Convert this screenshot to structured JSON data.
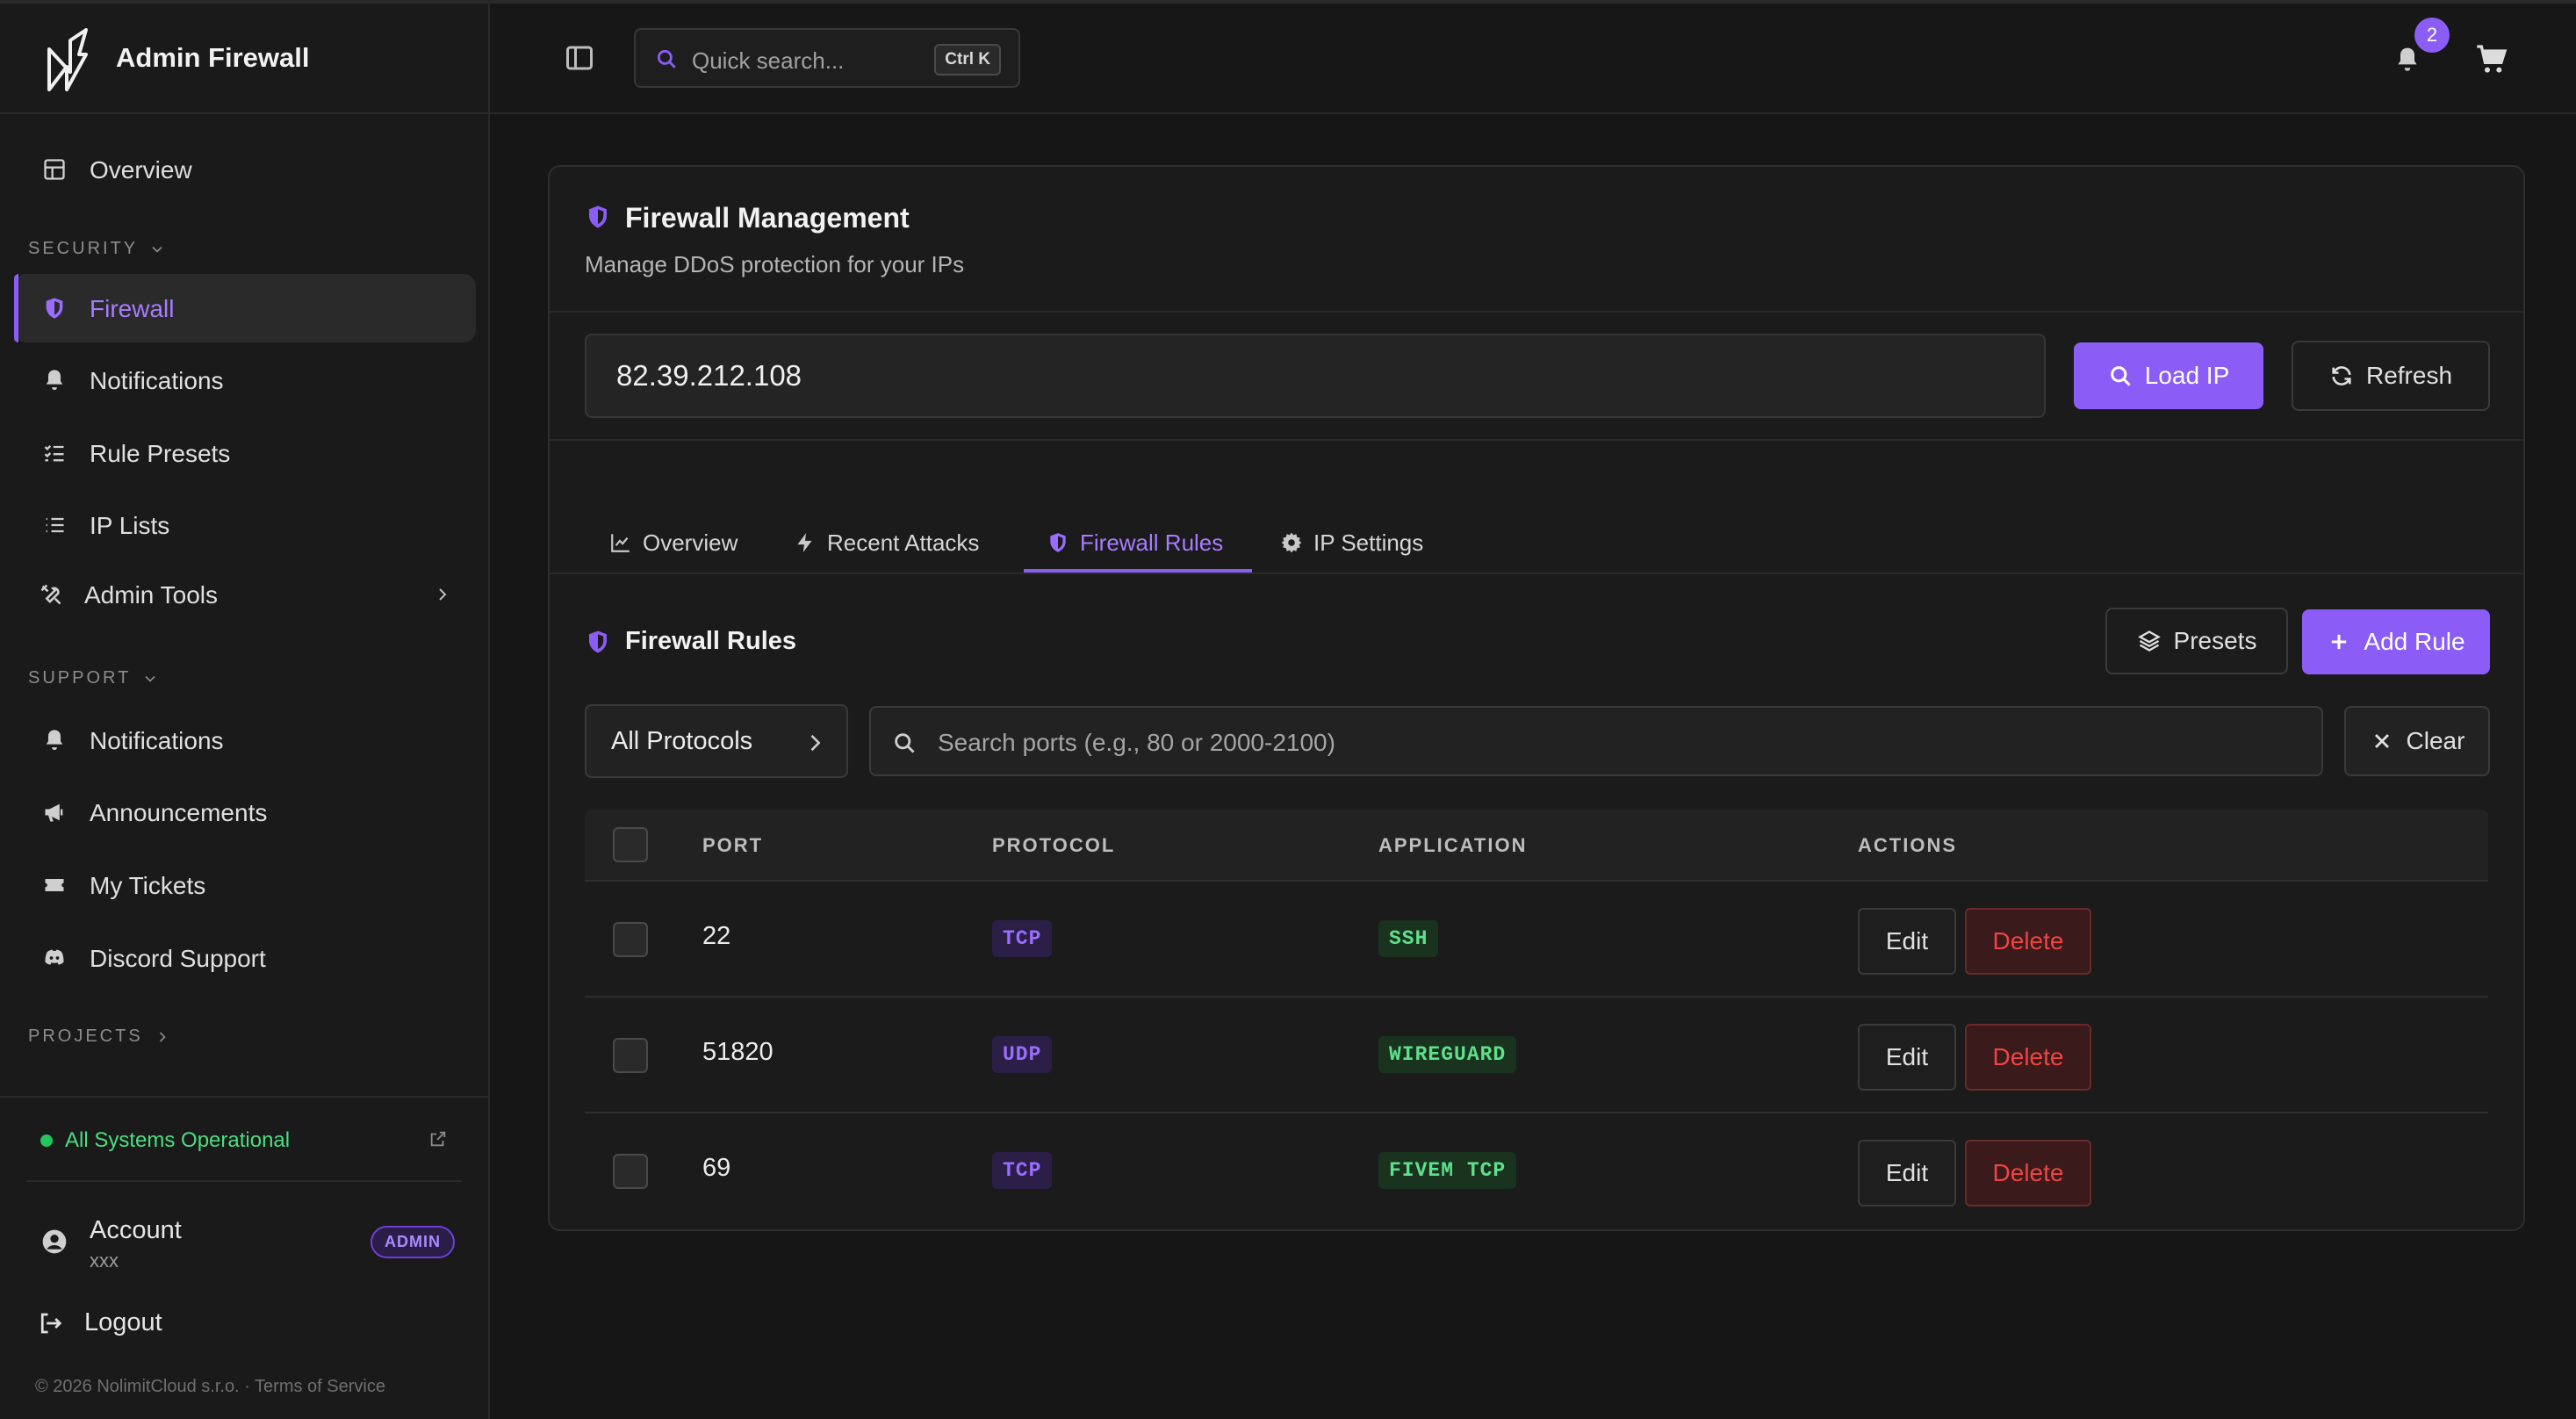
{
  "app": {
    "title": "Admin Firewall"
  },
  "sidebar": {
    "overview": "Overview",
    "security_label": "SECURITY",
    "security_items": [
      {
        "label": "Firewall",
        "icon": "shield-icon",
        "active": true
      },
      {
        "label": "Notifications",
        "icon": "bell-icon"
      },
      {
        "label": "Rule Presets",
        "icon": "list-checks-icon"
      },
      {
        "label": "IP Lists",
        "icon": "list-icon"
      },
      {
        "label": "Admin Tools",
        "icon": "wrench-icon"
      }
    ],
    "support_label": "SUPPORT",
    "support_items": [
      {
        "label": "Notifications",
        "icon": "bell-icon"
      },
      {
        "label": "Announcements",
        "icon": "megaphone-icon"
      },
      {
        "label": "My Tickets",
        "icon": "ticket-icon"
      },
      {
        "label": "Discord Support",
        "icon": "discord-icon"
      }
    ],
    "projects_label": "PROJECTS",
    "status": "All Systems Operational",
    "account": {
      "name": "Account",
      "sub": "xxx",
      "badge": "ADMIN"
    },
    "logout": "Logout",
    "footer": "© 2026 NolimitCloud s.r.o. · Terms of Service"
  },
  "topbar": {
    "search_placeholder": "Quick search...",
    "shortcut": "Ctrl K",
    "notification_count": "2"
  },
  "main": {
    "title": "Firewall Management",
    "subtitle": "Manage DDoS protection for your IPs",
    "ip_value": "82.39.212.108",
    "load_button": "Load IP",
    "refresh_button": "Refresh",
    "tabs": [
      {
        "label": "Overview",
        "icon": "chart-line-icon"
      },
      {
        "label": "Recent Attacks",
        "icon": "bolt-icon"
      },
      {
        "label": "Firewall Rules",
        "icon": "shield-icon",
        "active": true
      },
      {
        "label": "IP Settings",
        "icon": "gear-icon"
      }
    ],
    "rules": {
      "title": "Firewall Rules",
      "presets_button": "Presets",
      "add_button": "Add Rule",
      "protocol_filter": "All Protocols",
      "port_search_placeholder": "Search ports (e.g., 80 or 2000-2100)",
      "clear_button": "Clear",
      "columns": [
        "PORT",
        "PROTOCOL",
        "APPLICATION",
        "ACTIONS"
      ],
      "rows": [
        {
          "port": "22",
          "protocol": "TCP",
          "application": "SSH"
        },
        {
          "port": "51820",
          "protocol": "UDP",
          "application": "WIREGUARD"
        },
        {
          "port": "69",
          "protocol": "TCP",
          "application": "FIVEM TCP"
        }
      ],
      "edit_label": "Edit",
      "delete_label": "Delete"
    }
  },
  "colors": {
    "accent": "#8b5cf6",
    "background": "#161616",
    "success": "#22c55e",
    "danger": "#ef4444"
  }
}
